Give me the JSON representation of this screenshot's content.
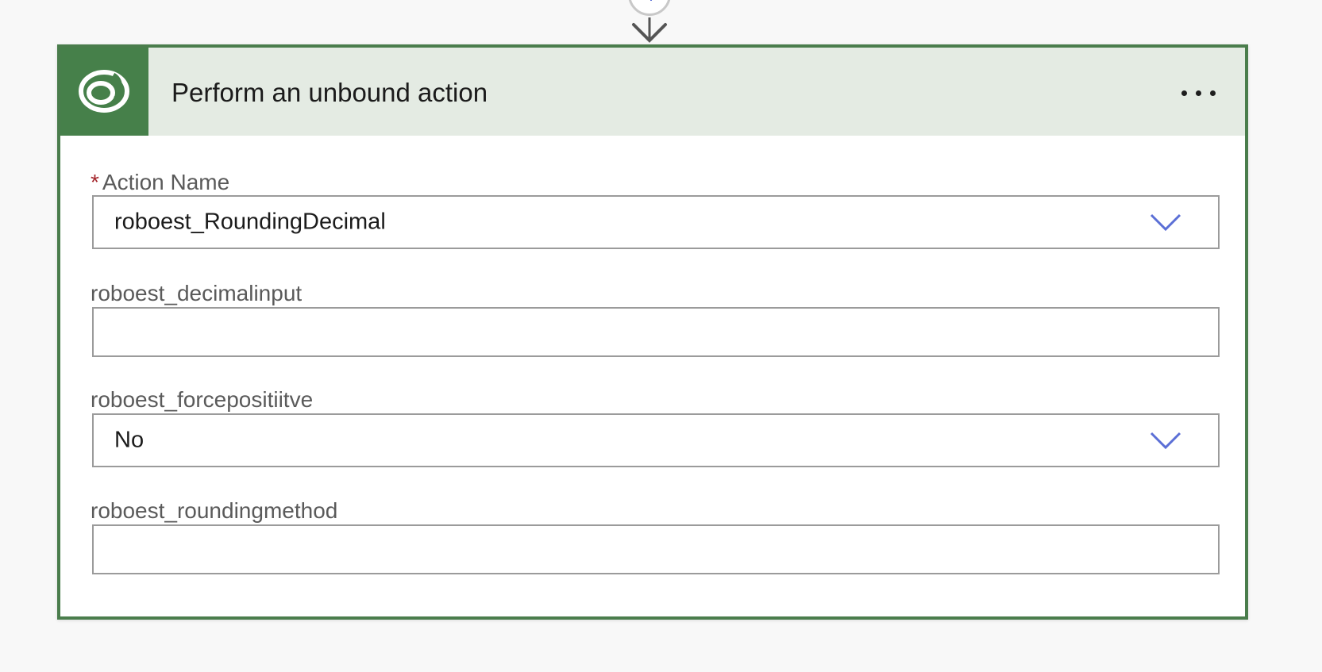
{
  "card": {
    "title": "Perform an unbound action",
    "header_color": "#e4ebe3",
    "icon_bg_color": "#46804a",
    "border_color": "#4a7d4c",
    "icon": "dataverse-logo-icon",
    "more_icon": "more-options-icon"
  },
  "fields": {
    "action_name": {
      "label": "Action Name",
      "required_marker": "*",
      "value": "roboest_RoundingDecimal",
      "control": "dropdown"
    },
    "decimalinput": {
      "label": "roboest_decimalinput",
      "value": "",
      "control": "text"
    },
    "forcepositive": {
      "label": "roboest_forcepositiitve",
      "value": "No",
      "control": "dropdown"
    },
    "roundingmethod": {
      "label": "roboest_roundingmethod",
      "value": "",
      "control": "text"
    }
  },
  "accent_color": "#5b6fd6"
}
